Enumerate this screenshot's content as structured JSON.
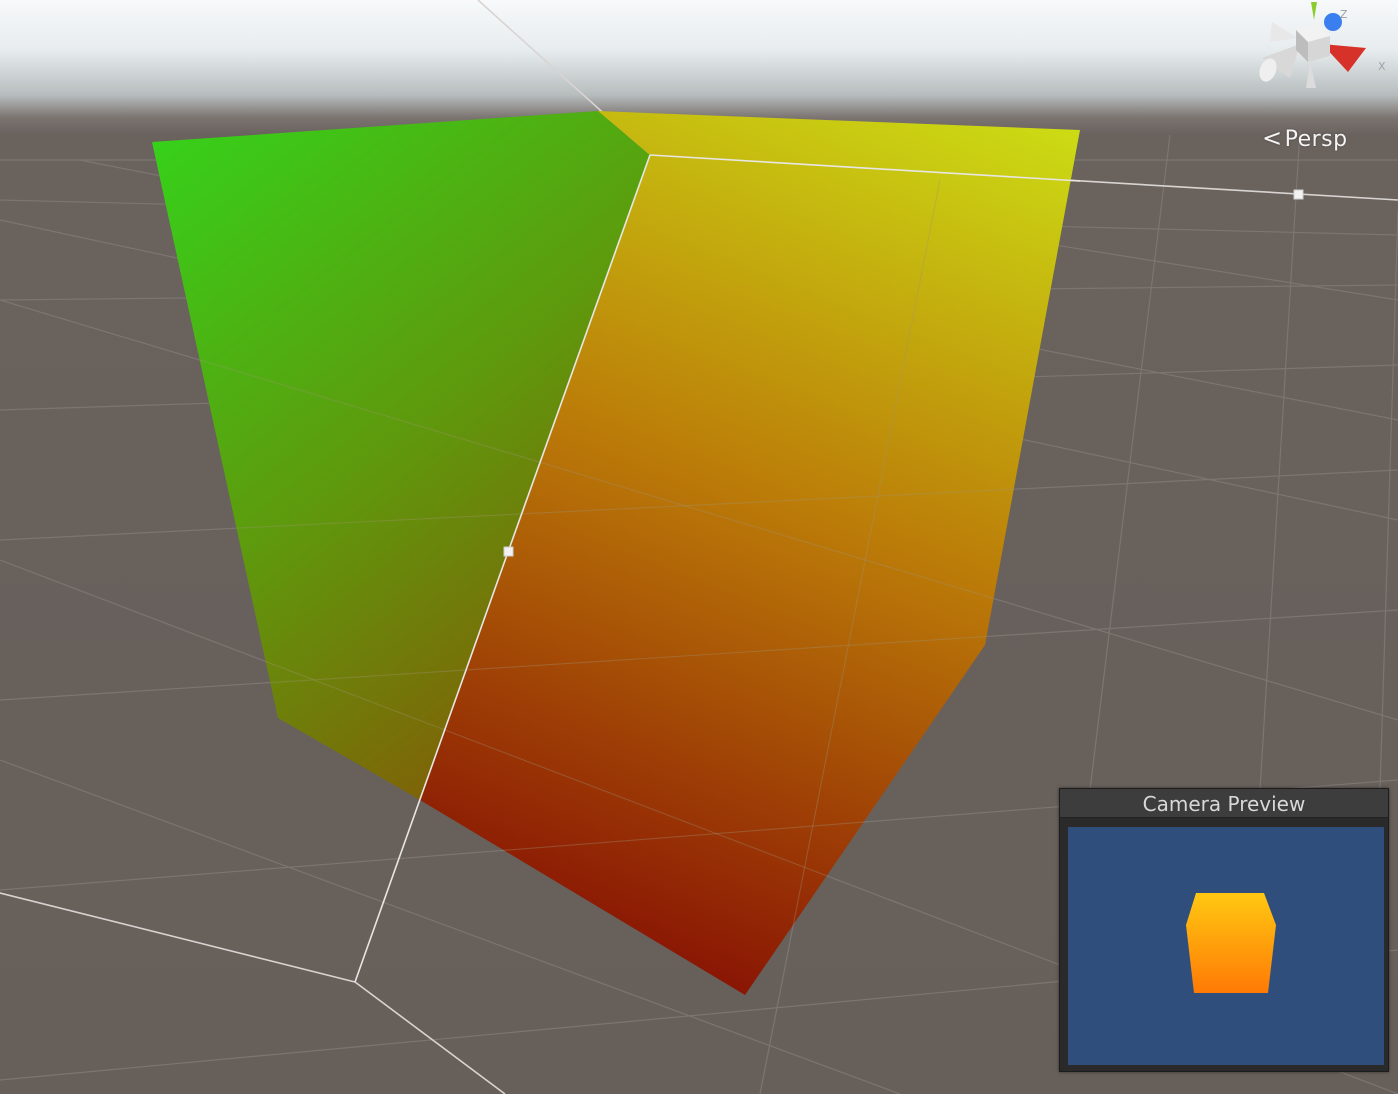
{
  "scene_view": {
    "projection_label": "Persp",
    "gizmo_axes": {
      "x": "X",
      "y": "Y",
      "z": "Z"
    },
    "colors": {
      "ground": "#675f5a",
      "sky": "#f7f9fa",
      "cube_top_left": "#36d11a",
      "cube_top_right": "#ccdc14",
      "cube_bottom": "#871605",
      "axis_x": "#d7322a",
      "axis_y": "#8acd2c",
      "axis_z": "#3a7ef0"
    }
  },
  "camera_preview": {
    "title": "Camera Preview",
    "background_color": "#2f4e7c",
    "cube_colors": [
      "#ffc812",
      "#ff7a05"
    ]
  }
}
